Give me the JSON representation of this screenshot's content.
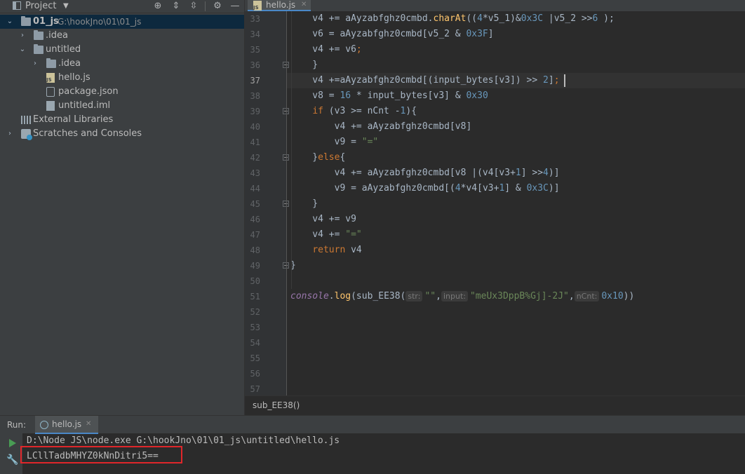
{
  "project_panel": {
    "title": "Project",
    "dropdown_arrow": "▼",
    "tools": [
      {
        "name": "locate-icon",
        "glyph": "⊕"
      },
      {
        "name": "expand-all-icon",
        "glyph": "⇕"
      },
      {
        "name": "collapse-all-icon",
        "glyph": "⇳"
      },
      {
        "name": "settings-icon",
        "glyph": "⚙"
      },
      {
        "name": "hide-icon",
        "glyph": "—"
      }
    ],
    "tree": [
      {
        "label": "01_js",
        "path": "G:\\hookJno\\01\\01_js",
        "icon": "folder",
        "arrow": "⌄",
        "depth": 0
      },
      {
        "label": ".idea",
        "icon": "folder",
        "arrow": "›",
        "depth": 1
      },
      {
        "label": "untitled",
        "icon": "folder",
        "arrow": "⌄",
        "depth": 1
      },
      {
        "label": ".idea",
        "icon": "folder",
        "arrow": "›",
        "depth": 2
      },
      {
        "label": "hello.js",
        "icon": "js-file",
        "arrow": "",
        "depth": 2
      },
      {
        "label": "package.json",
        "icon": "json-file",
        "arrow": "",
        "depth": 2
      },
      {
        "label": "untitled.iml",
        "icon": "iml-file",
        "arrow": "",
        "depth": 2
      },
      {
        "label": "External Libraries",
        "icon": "library",
        "arrow": "",
        "depth": 0
      },
      {
        "label": "Scratches and Consoles",
        "icon": "scratch",
        "arrow": "›",
        "depth": 0
      }
    ]
  },
  "editor": {
    "tab": {
      "label": "hello.js",
      "close": "✕"
    },
    "line_numbers": [
      "33",
      "34",
      "35",
      "36",
      "37",
      "38",
      "39",
      "40",
      "41",
      "42",
      "43",
      "44",
      "45",
      "46",
      "47",
      "48",
      "49",
      "50",
      "51",
      "52",
      "53",
      "54",
      "55",
      "56",
      "57"
    ],
    "current_line": "37",
    "lines": [
      [
        {
          "t": "    v4 += aAyzabfghz0cmbd.",
          "c": ""
        },
        {
          "t": "charAt",
          "c": "fn"
        },
        {
          "t": "((",
          "c": ""
        },
        {
          "t": "4",
          "c": "num"
        },
        {
          "t": "*v5_1)&",
          "c": ""
        },
        {
          "t": "0x3C",
          "c": "num"
        },
        {
          "t": " |v5_2 >>",
          "c": ""
        },
        {
          "t": "6",
          "c": "num"
        },
        {
          "t": " );",
          "c": ""
        }
      ],
      [
        {
          "t": "    v6 = aAyzabfghz0cmbd[v5_2 & ",
          "c": ""
        },
        {
          "t": "0x3F",
          "c": "num"
        },
        {
          "t": "]",
          "c": ""
        }
      ],
      [
        {
          "t": "    v4 += v6",
          "c": ""
        },
        {
          "t": ";",
          "c": "kw"
        }
      ],
      [
        {
          "t": "    }",
          "c": ""
        }
      ],
      [
        {
          "t": "    v4 +=aAyzabfghz0cmbd[(input_bytes[v3]) >> ",
          "c": ""
        },
        {
          "t": "2",
          "c": "num"
        },
        {
          "t": "]",
          "c": ""
        },
        {
          "t": ";",
          "c": "kw"
        }
      ],
      [
        {
          "t": "    v8 = ",
          "c": ""
        },
        {
          "t": "16",
          "c": "num"
        },
        {
          "t": " * input_bytes[v3] & ",
          "c": ""
        },
        {
          "t": "0x30",
          "c": "num"
        }
      ],
      [
        {
          "t": "    ",
          "c": ""
        },
        {
          "t": "if",
          "c": "kw"
        },
        {
          "t": " (v3 >= nCnt -",
          "c": ""
        },
        {
          "t": "1",
          "c": "num"
        },
        {
          "t": "){",
          "c": ""
        }
      ],
      [
        {
          "t": "        v4 += aAyzabfghz0cmbd[v8]",
          "c": ""
        }
      ],
      [
        {
          "t": "        v9 = ",
          "c": ""
        },
        {
          "t": "\"=\"",
          "c": "str"
        }
      ],
      [
        {
          "t": "    }",
          "c": ""
        },
        {
          "t": "else",
          "c": "kw"
        },
        {
          "t": "{",
          "c": ""
        }
      ],
      [
        {
          "t": "        v4 += aAyzabfghz0cmbd[v8 |(v4[v3+",
          "c": ""
        },
        {
          "t": "1",
          "c": "num"
        },
        {
          "t": "] >>",
          "c": ""
        },
        {
          "t": "4",
          "c": "num"
        },
        {
          "t": ")]",
          "c": ""
        }
      ],
      [
        {
          "t": "        v9 = aAyzabfghz0cmbd[(",
          "c": ""
        },
        {
          "t": "4",
          "c": "num"
        },
        {
          "t": "*v4[v3+",
          "c": ""
        },
        {
          "t": "1",
          "c": "num"
        },
        {
          "t": "] & ",
          "c": ""
        },
        {
          "t": "0x3C",
          "c": "num"
        },
        {
          "t": ")]",
          "c": ""
        }
      ],
      [
        {
          "t": "    }",
          "c": ""
        }
      ],
      [
        {
          "t": "    v4 += v9",
          "c": ""
        }
      ],
      [
        {
          "t": "    v4 += ",
          "c": ""
        },
        {
          "t": "\"=\"",
          "c": "str"
        }
      ],
      [
        {
          "t": "    ",
          "c": ""
        },
        {
          "t": "return",
          "c": "kw"
        },
        {
          "t": " v4",
          "c": ""
        }
      ],
      [
        {
          "t": "}",
          "c": ""
        }
      ],
      [],
      [
        {
          "t": "console",
          "c": "con"
        },
        {
          "t": ".",
          "c": ""
        },
        {
          "t": "log",
          "c": "fn"
        },
        {
          "t": "(sub_EE38(",
          "c": ""
        },
        {
          "t": "str:",
          "c": "hint"
        },
        {
          "t": "\"\"",
          "c": "str"
        },
        {
          "t": ",",
          "c": ""
        },
        {
          "t": "input:",
          "c": "hint"
        },
        {
          "t": "\"meUx3DppB%Gj]-2J\"",
          "c": "str"
        },
        {
          "t": ",",
          "c": ""
        },
        {
          "t": "nCnt:",
          "c": "hint"
        },
        {
          "t": "0x10",
          "c": "num"
        },
        {
          "t": "))",
          "c": ""
        }
      ],
      [],
      [],
      [],
      [],
      [],
      []
    ],
    "breadcrumb": "sub_EE38()"
  },
  "run_panel": {
    "label": "Run:",
    "tab": {
      "label": "hello.js",
      "close": "✕"
    },
    "command": "D:\\Node JS\\node.exe G:\\hookJno\\01\\01_js\\untitled\\hello.js",
    "output": "LCllTadbMHYZ0kNnDitri5==",
    "highlight_color": "#e0262a"
  },
  "colors": {
    "keyword": "#cc7832",
    "number": "#6897bb",
    "string": "#6a8759",
    "function": "#ffc66d",
    "accent": "#4a88c7"
  }
}
